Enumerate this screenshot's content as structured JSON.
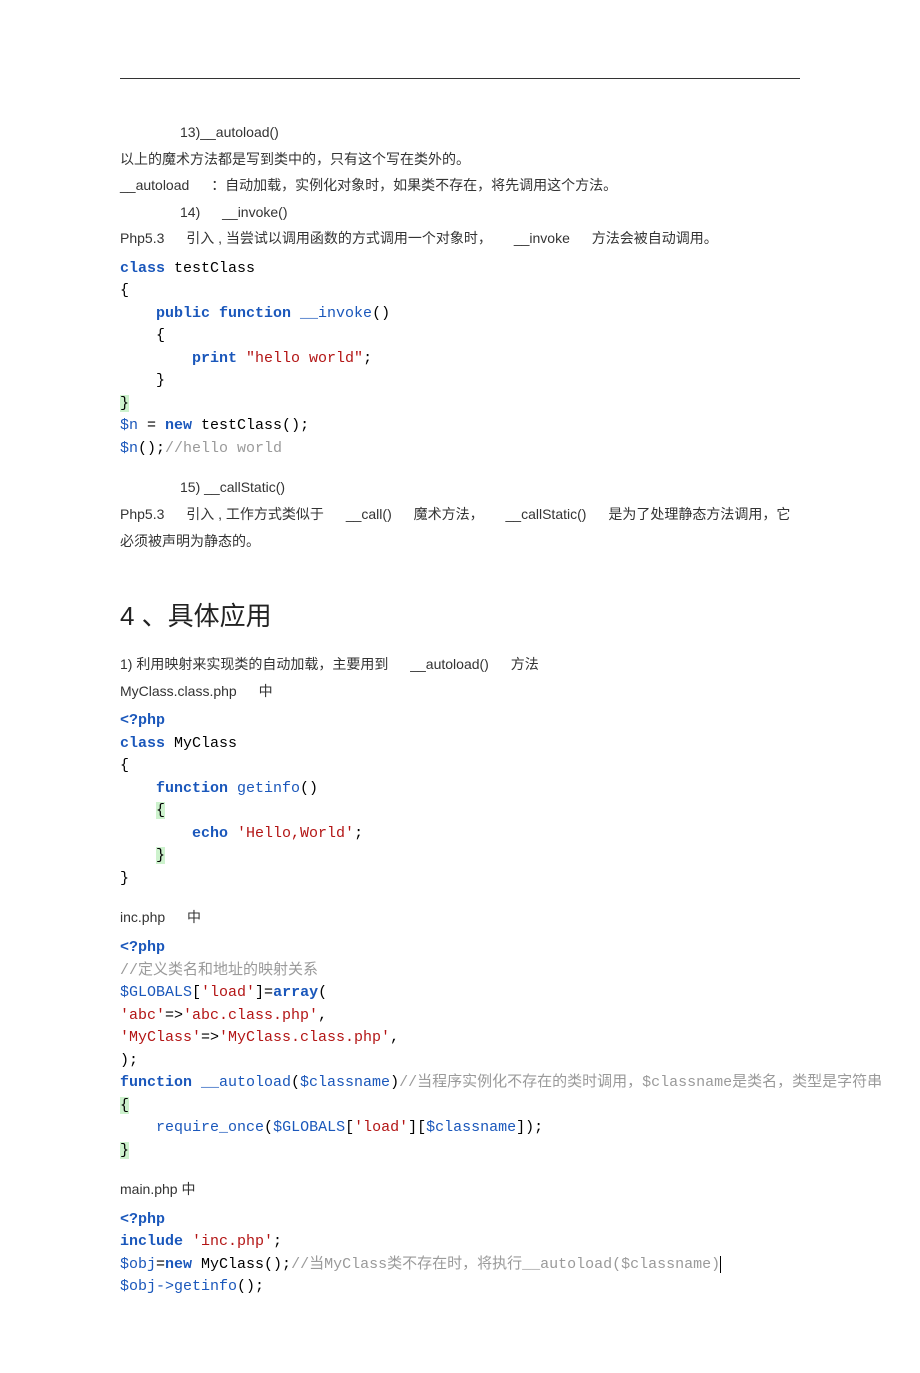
{
  "items": {
    "item13_label": "13)__autoload()",
    "item13_p1": "以上的魔术方法都是写到类中的，只有这个写在类外的。",
    "item13_p2a": "__autoload",
    "item13_p2b": "：自动加载，实例化对象时，如果类不存在，将先调用这个方法。",
    "item14_label_a": "14)",
    "item14_label_b": "__invoke()",
    "item14_p1a": "Php5.3",
    "item14_p1b": "引入 , 当尝试以调用函数的方式调用一个对象时，",
    "item14_p1c": "__invoke",
    "item14_p1d": "方法会被自动调用。",
    "item15_label": "15) __callStatic()",
    "item15_p1a": "Php5.3",
    "item15_p1b": "引入 , 工作方式类似于",
    "item15_p1c": "__call()",
    "item15_p1d": "魔术方法，",
    "item15_p1e": "__callStatic()",
    "item15_p1f": "是为了处理静态方法调用，它必须被声明为静态的。"
  },
  "section4": {
    "heading": "4 、具体应用",
    "p1a": "1) 利用映射来实现类的自动加载，主要用到",
    "p1b": "__autoload()",
    "p1c": "方法",
    "file1_a": "MyClass.class.php",
    "file1_b": "中",
    "file2_a": "inc.php",
    "file2_b": "中",
    "file3": "main.php 中"
  },
  "code": {
    "invoke": {
      "l1a": "class",
      "l1b": " testClass",
      "l2": "{",
      "l3a": "public function ",
      "l3b": "__invoke",
      "l3c": "()",
      "l4": "{",
      "l5a": "print ",
      "l5b": "\"hello world\"",
      "l5c": ";",
      "l6": "}",
      "l7": "}",
      "l8a": "$n",
      "l8b": " = ",
      "l8c": "new",
      "l8d": " testClass();",
      "l9a": "$n",
      "l9b": "();",
      "l9c": "//hello world"
    },
    "myclass": {
      "l1": "<?php",
      "l2a": "class",
      "l2b": " MyClass",
      "l3": "{",
      "l4a": "function ",
      "l4b": "getinfo",
      "l4c": "()",
      "l5": "{",
      "l6a": "echo ",
      "l6b": "'Hello,World'",
      "l6c": ";",
      "l7": "}",
      "l8": "}"
    },
    "inc": {
      "l1": "<?php",
      "l2": "//定义类名和地址的映射关系",
      "l3a": "$GLOBALS",
      "l3b": "[",
      "l3c": "'load'",
      "l3d": "]=",
      "l3e": "array",
      "l3f": "(",
      "l4a": "'abc'",
      "l4b": "=>",
      "l4c": "'abc.class.php'",
      "l4d": ",",
      "l5a": "'MyClass'",
      "l5b": "=>",
      "l5c": "'MyClass.class.php'",
      "l5d": ",",
      "l6": ");",
      "l7a": "function ",
      "l7b": "__autoload",
      "l7c": "(",
      "l7d": "$classname",
      "l7e": ")",
      "l7f": "//当程序实例化不存在的类时调用，$classname是类名，类型是字符串",
      "l8": "{",
      "l9a": "require_once",
      "l9b": "(",
      "l9c": "$GLOBALS",
      "l9d": "[",
      "l9e": "'load'",
      "l9f": "][",
      "l9g": "$classname",
      "l9h": "]);",
      "l10": "}"
    },
    "main": {
      "l1": "<?php",
      "l2a": "include ",
      "l2b": "'inc.php'",
      "l2c": ";",
      "l3a": "$obj",
      "l3b": "=",
      "l3c": "new",
      "l3d": " MyClass();",
      "l3e": "//当MyClass类不存在时，将执行__autoload($classname)",
      "l4a": "$obj",
      "l4b": "->",
      "l4c": "getinfo",
      "l4d": "();"
    }
  }
}
